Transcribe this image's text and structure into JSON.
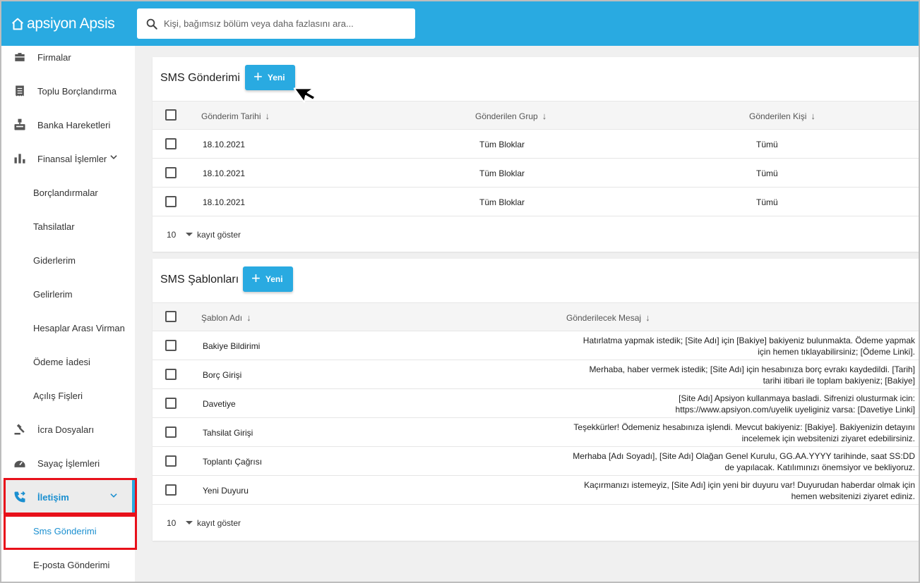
{
  "app": {
    "logo": "apsiyon Apsis"
  },
  "search": {
    "placeholder": "Kişi, bağımsız bölüm veya daha fazlasını ara..."
  },
  "sidebar": {
    "items": [
      {
        "label": "Firmalar",
        "icon": "briefcase-icon"
      },
      {
        "label": "Toplu Borçlandırma",
        "icon": "receipt-icon"
      },
      {
        "label": "Banka Hareketleri",
        "icon": "bank-icon"
      },
      {
        "label": "Finansal İşlemler",
        "icon": "bar-chart-icon"
      },
      {
        "label": "Borçlandırmalar"
      },
      {
        "label": "Tahsilatlar"
      },
      {
        "label": "Giderlerim"
      },
      {
        "label": "Gelirlerim"
      },
      {
        "label": "Hesaplar Arası Virman"
      },
      {
        "label": "Ödeme İadesi"
      },
      {
        "label": "Açılış Fişleri"
      },
      {
        "label": "İcra Dosyaları",
        "icon": "gavel-icon"
      },
      {
        "label": "Sayaç İşlemleri",
        "icon": "meter-icon"
      },
      {
        "label": "İletişim",
        "icon": "phone-forward-icon"
      },
      {
        "label": "Sms Gönderimi"
      },
      {
        "label": "E-posta Gönderimi"
      }
    ]
  },
  "sms_sending": {
    "title": "SMS Gönderimi",
    "new_label": "Yeni",
    "columns": [
      "Gönderim Tarihi",
      "Gönderilen Grup",
      "Gönderilen Kişi"
    ],
    "rows": [
      {
        "date": "18.10.2021",
        "group": "Tüm Bloklar",
        "person": "Tümü"
      },
      {
        "date": "18.10.2021",
        "group": "Tüm Bloklar",
        "person": "Tümü"
      },
      {
        "date": "18.10.2021",
        "group": "Tüm Bloklar",
        "person": "Tümü"
      }
    ],
    "page_size": "10",
    "page_size_label": "kayıt göster"
  },
  "sms_templates": {
    "title": "SMS Şablonları",
    "new_label": "Yeni",
    "columns": [
      "Şablon Adı",
      "Gönderilecek Mesaj"
    ],
    "rows": [
      {
        "name": "Bakiye Bildirimi",
        "msg1": "Hatırlatma yapmak istedik; [Site Adı] için [Bakiye] bakiyeniz bulunmakta. Ödeme yapmak",
        "msg2": "için hemen tıklayabilirsiniz; [Ödeme Linki]."
      },
      {
        "name": "Borç Girişi",
        "msg1": "Merhaba, haber vermek istedik; [Site Adı] için hesabınıza borç evrakı kaydedildi. [Tarih]",
        "msg2": "tarihi itibari ile toplam bakiyeniz; [Bakiye]"
      },
      {
        "name": "Davetiye",
        "msg1": "[Site Adı] Apsiyon kullanmaya basladi. Sifrenizi olusturmak icin:",
        "msg2": "https://www.apsiyon.com/uyelik uyeliginiz varsa: [Davetiye Linki]"
      },
      {
        "name": "Tahsilat Girişi",
        "msg1": "Teşekkürler! Ödemeniz hesabınıza işlendi. Mevcut bakiyeniz: [Bakiye]. Bakiyenizin detayını",
        "msg2": "incelemek için websitenizi ziyaret edebilirsiniz."
      },
      {
        "name": "Toplantı Çağrısı",
        "msg1": "Merhaba [Adı Soyadı], [Site Adı] Olağan Genel Kurulu, GG.AA.YYYY tarihinde, saat SS:DD",
        "msg2": "de yapılacak. Katılımınızı önemsiyor ve bekliyoruz."
      },
      {
        "name": "Yeni Duyuru",
        "msg1": "Kaçırmanızı istemeyiz, [Site Adı] için yeni bir duyuru var! Duyurudan haberdar olmak için",
        "msg2": "hemen websitenizi ziyaret ediniz."
      }
    ],
    "page_size": "10",
    "page_size_label": "kayıt göster"
  },
  "colors": {
    "primary": "#29aae1",
    "highlight": "#e8101a"
  }
}
